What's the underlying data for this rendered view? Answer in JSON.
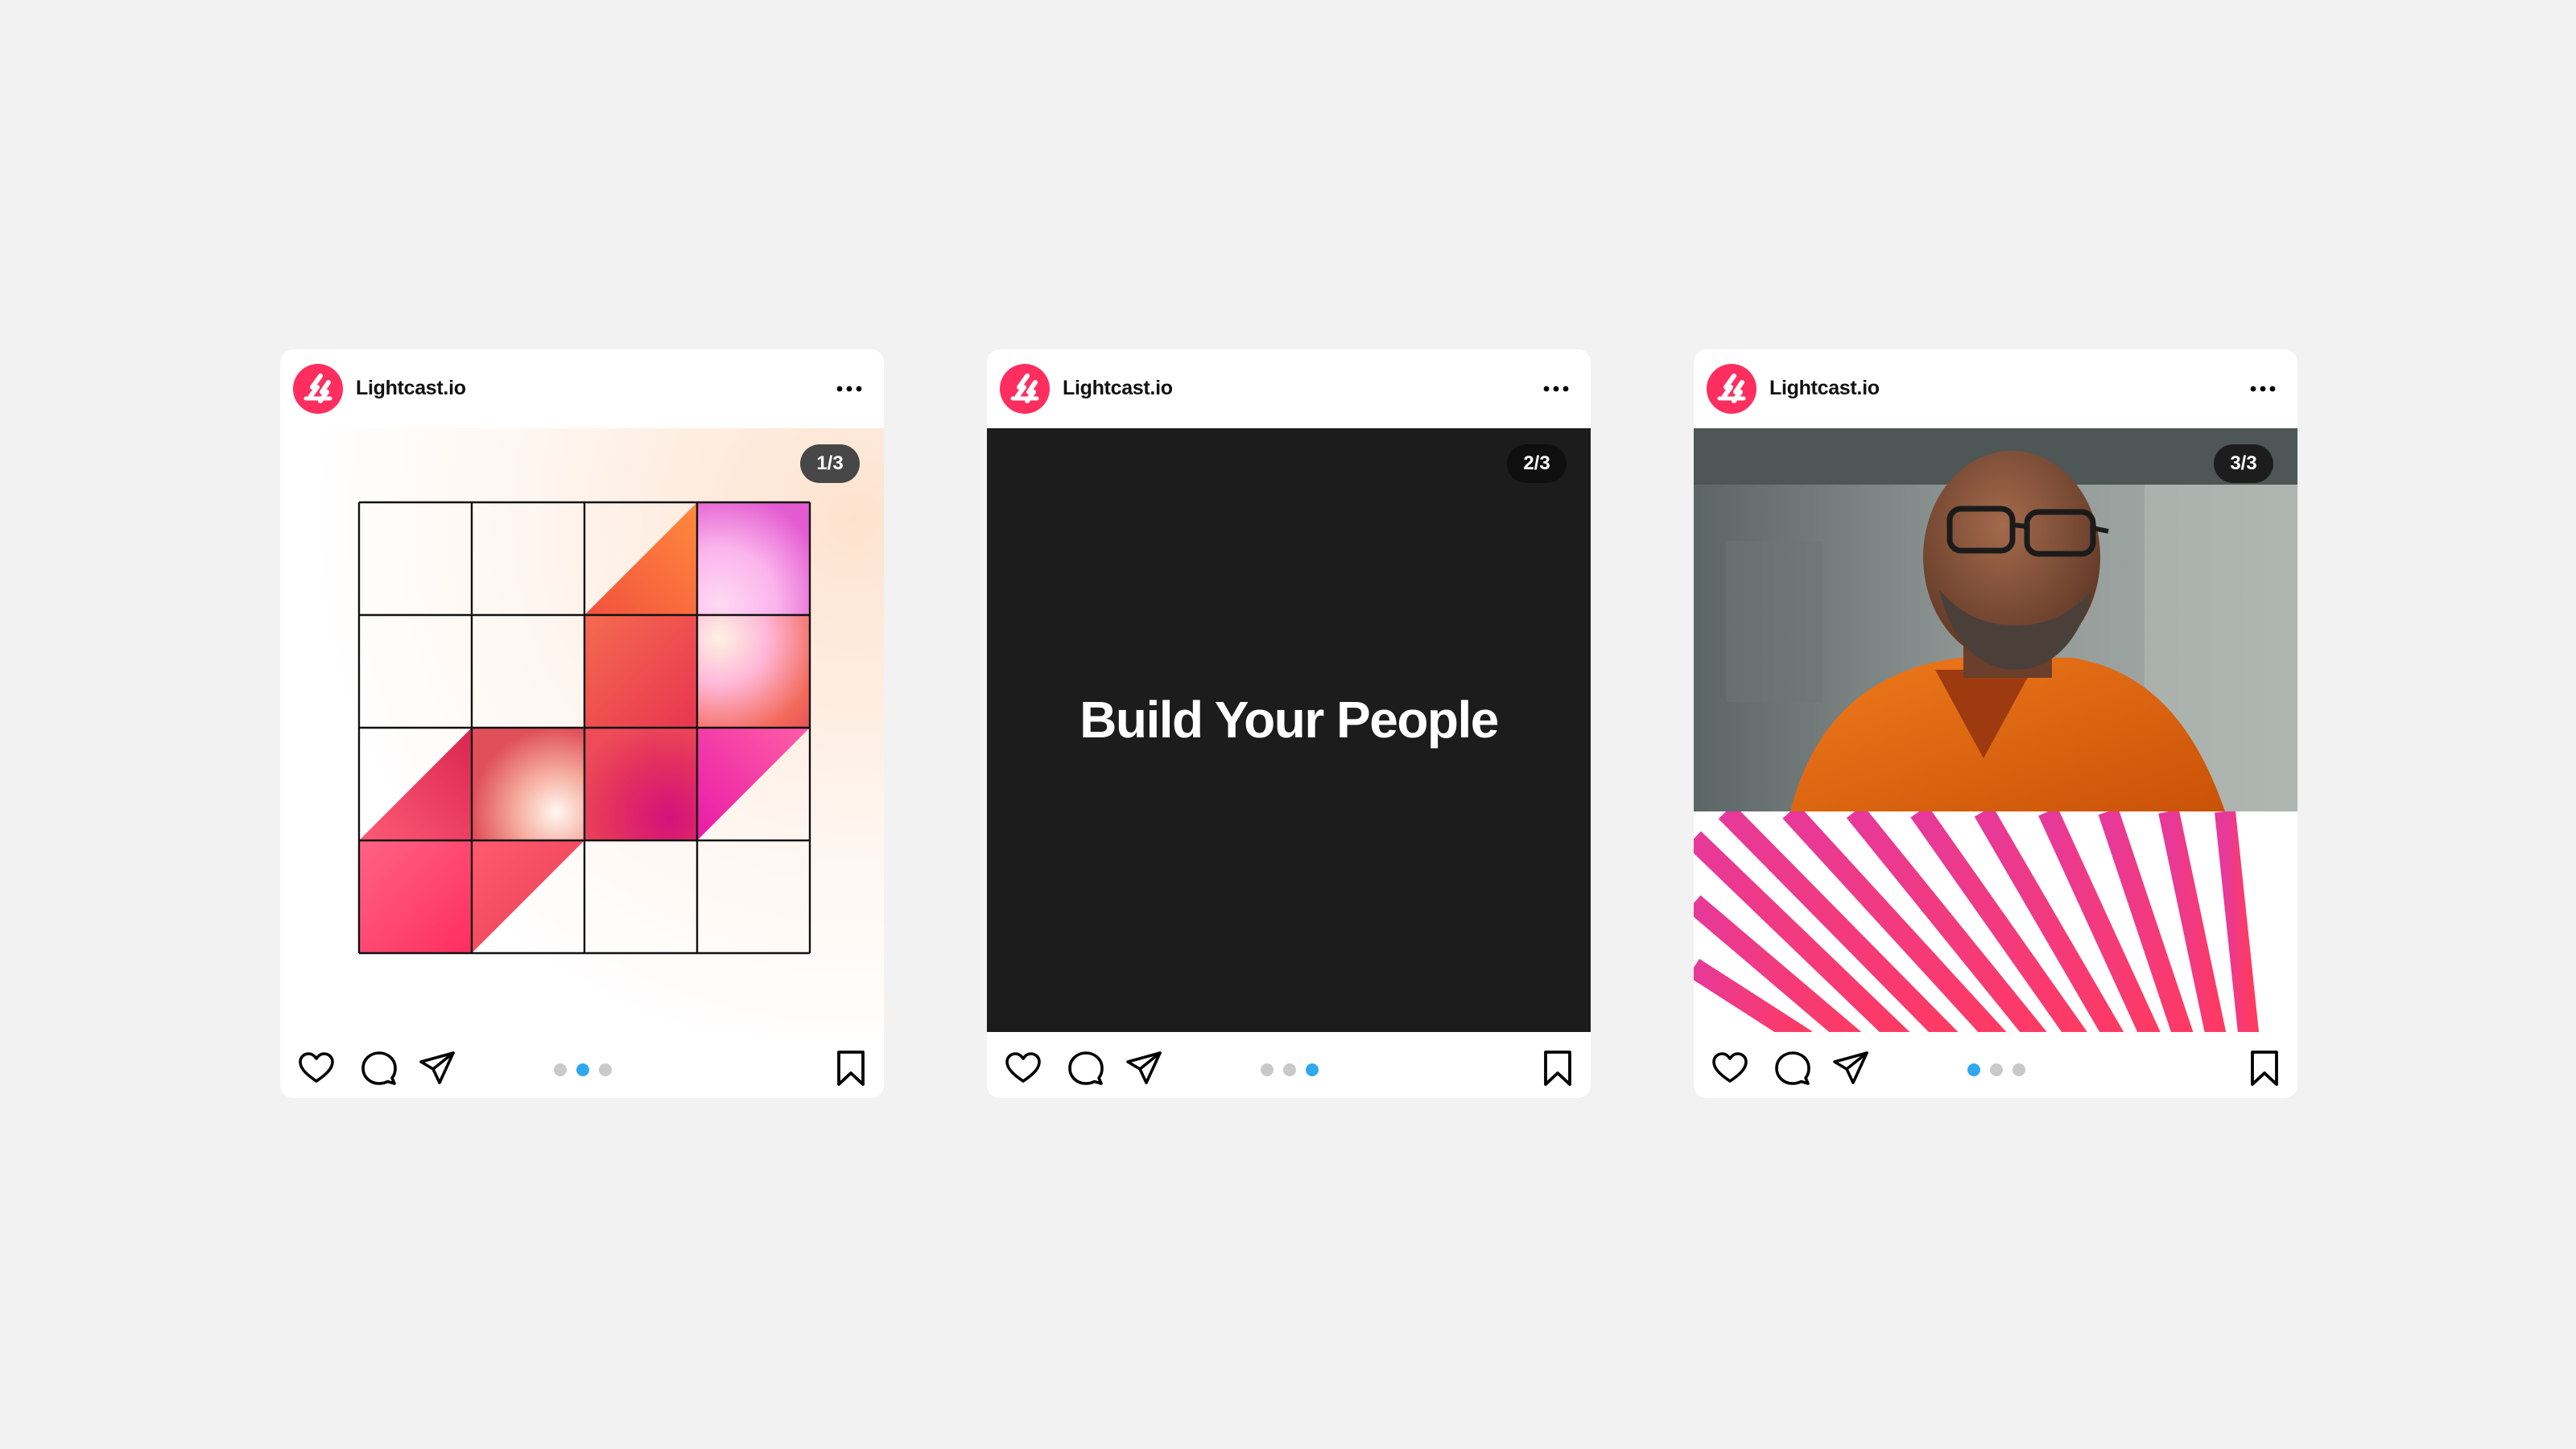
{
  "posts": [
    {
      "account": "Lightcast.io",
      "page": "1/3",
      "carousel_active_index": 1,
      "media": "pink-orange gradient grid artwork"
    },
    {
      "account": "Lightcast.io",
      "page": "2/3",
      "carousel_active_index": 2,
      "slide_text": "Build Your People"
    },
    {
      "account": "Lightcast.io",
      "page": "3/3",
      "carousel_active_index": 0,
      "media": "portrait photo with pink striped graphic"
    }
  ],
  "colors": {
    "background": "#f2f2f2",
    "brand": "#ff2e5f",
    "dot_active": "#31a8ee",
    "dot_inactive": "#c9c9c9",
    "slide_dark": "#1c1c1c"
  },
  "icons": [
    "lightcast-logo-icon",
    "more-icon",
    "heart-icon",
    "comment-icon",
    "share-icon",
    "bookmark-icon"
  ]
}
